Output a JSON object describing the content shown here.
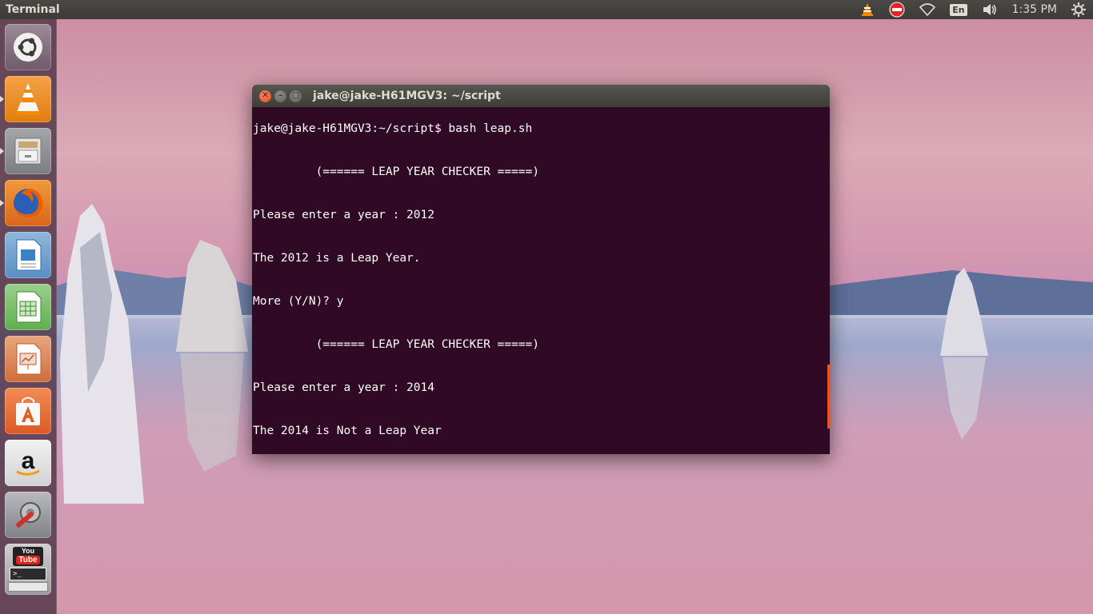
{
  "top_panel": {
    "app_title": "Terminal",
    "language": "En",
    "clock": "1:35 PM"
  },
  "launcher": {
    "items": [
      {
        "name": "ubuntu-dash",
        "icon": "ubuntu-logo-icon"
      },
      {
        "name": "vlc",
        "icon": "vlc-cone-icon",
        "running": true
      },
      {
        "name": "files",
        "icon": "file-cabinet-icon",
        "running": true
      },
      {
        "name": "firefox",
        "icon": "firefox-icon",
        "running": true
      },
      {
        "name": "libreoffice-writer",
        "icon": "writer-document-icon"
      },
      {
        "name": "libreoffice-calc",
        "icon": "calc-spreadsheet-icon"
      },
      {
        "name": "libreoffice-impress",
        "icon": "impress-presentation-icon"
      },
      {
        "name": "software-center",
        "icon": "shopping-bag-icon"
      },
      {
        "name": "amazon",
        "icon": "amazon-icon"
      },
      {
        "name": "system-settings",
        "icon": "wrench-gear-icon"
      },
      {
        "name": "youtube-terminal",
        "icon": "youtube-terminal-icon"
      }
    ],
    "youtube_label_1": "You",
    "youtube_label_2": "Tube"
  },
  "terminal": {
    "window_title": "jake@jake-H61MGV3: ~/script",
    "lines": [
      "jake@jake-H61MGV3:~/script$ bash leap.sh",
      "         (====== LEAP YEAR CHECKER =====)",
      "Please enter a year : 2012",
      "The 2012 is a Leap Year.",
      "More (Y/N)? y",
      "         (====== LEAP YEAR CHECKER =====)",
      "Please enter a year : 2014",
      "The 2014 is Not a Leap Year"
    ]
  },
  "colors": {
    "terminal_bg": "#300a24",
    "accent": "#e95420",
    "panel_bg": "#3c3b37"
  }
}
